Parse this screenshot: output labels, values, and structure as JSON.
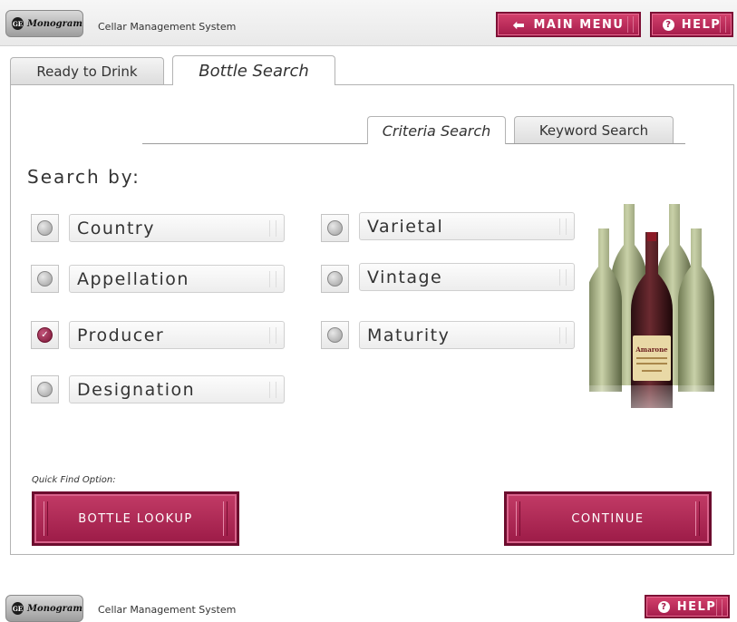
{
  "header": {
    "brand": "Monogram",
    "brand_mark": "GE",
    "app_title": "Cellar Management System",
    "main_menu_label": "MAIN MENU",
    "help_label": "HELP"
  },
  "tabs": [
    {
      "label": "Ready to Drink",
      "active": false
    },
    {
      "label": "Bottle Search",
      "active": true
    }
  ],
  "subtabs": [
    {
      "label": "Criteria Search",
      "active": true
    },
    {
      "label": "Keyword Search",
      "active": false
    }
  ],
  "search": {
    "heading": "Search by:",
    "options": [
      {
        "label": "Country",
        "checked": false
      },
      {
        "label": "Appellation",
        "checked": false
      },
      {
        "label": "Producer",
        "checked": true
      },
      {
        "label": "Designation",
        "checked": false
      },
      {
        "label": "Varietal",
        "checked": false
      },
      {
        "label": "Vintage",
        "checked": false
      },
      {
        "label": "Maturity",
        "checked": false
      }
    ]
  },
  "bottle_label_text": "Amarone",
  "quick_find": {
    "label": "Quick Find Option:",
    "lookup_button": "BOTTLE LOOKUP",
    "continue_button": "CONTINUE"
  },
  "footer": {
    "brand": "Monogram",
    "brand_mark": "GE",
    "app_title": "Cellar Management System",
    "help_label": "HELP"
  },
  "colors": {
    "accent": "#a51c4b",
    "accent_dark": "#6c0d2e"
  }
}
